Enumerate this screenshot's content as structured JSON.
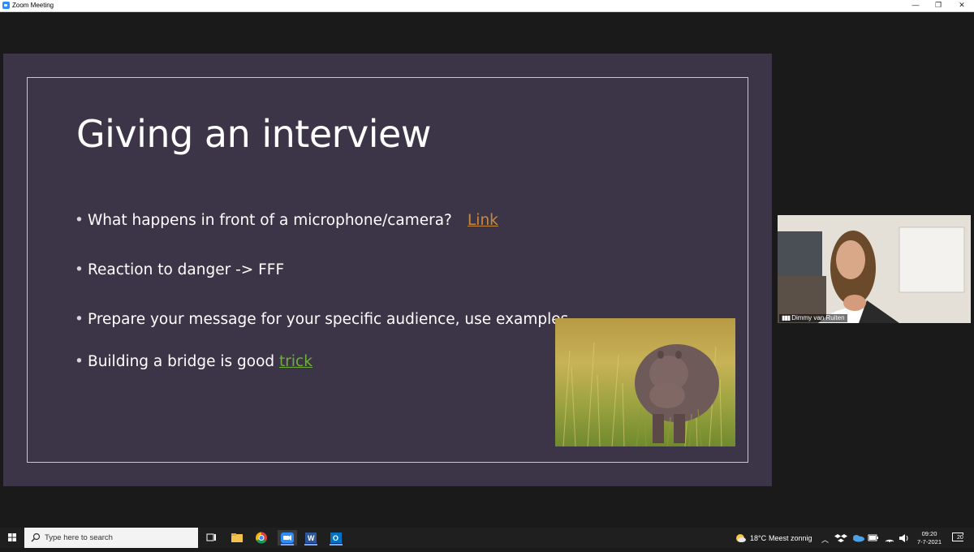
{
  "window": {
    "title": "Zoom Meeting",
    "minimize_label": "—",
    "maximize_label": "❐",
    "close_label": "✕"
  },
  "slide": {
    "title": "Giving an interview",
    "bullets": [
      {
        "text": "What happens in front of a microphone/camera?",
        "link": "Link"
      },
      {
        "text": "Reaction to danger -> FFF"
      },
      {
        "text": "Prepare your message for your specific audience, use examples"
      },
      {
        "text": "Building a bridge is good ",
        "link": "trick"
      }
    ],
    "link_colors": {
      "orange": "#c98a3d",
      "green": "#6fae3a"
    }
  },
  "video": {
    "participant_name": "Dimmy van Ruiten"
  },
  "taskbar": {
    "search_placeholder": "Type here to search",
    "weather_temp": "18°C",
    "weather_desc": "Meest zonnig",
    "time": "09:20",
    "date": "7-7-2021",
    "notification_count": "20"
  },
  "icons": [
    "windows-start-icon",
    "search-icon",
    "task-view-icon",
    "file-explorer-icon",
    "chrome-icon",
    "zoom-icon",
    "word-icon",
    "outlook-icon",
    "weather-icon",
    "chevron-up-icon",
    "dropbox-icon",
    "onedrive-icon",
    "battery-icon",
    "wifi-icon",
    "volume-icon",
    "notification-icon"
  ]
}
